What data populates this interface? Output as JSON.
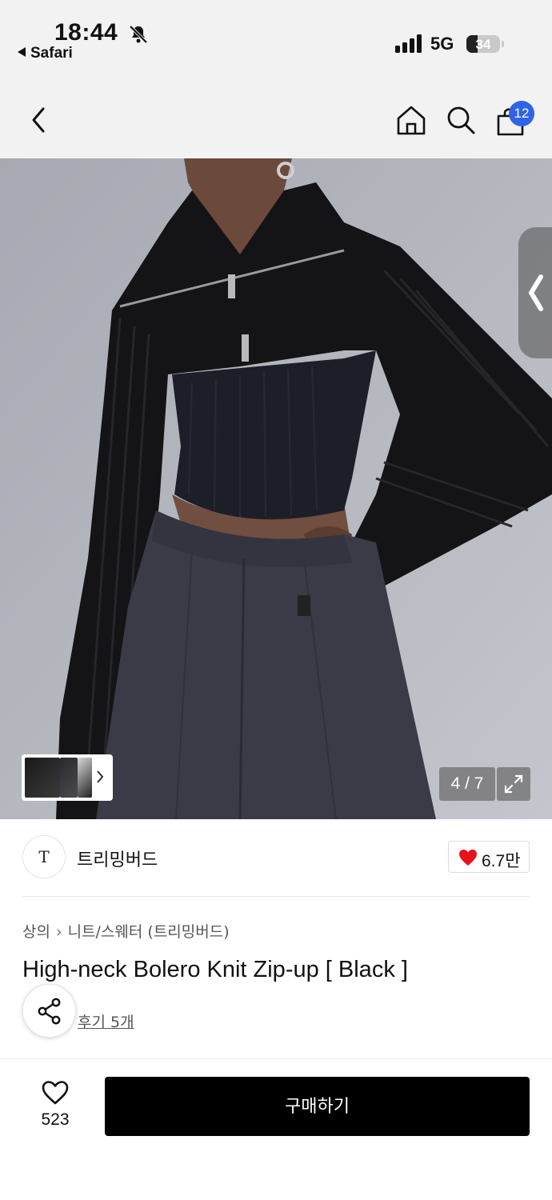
{
  "status_bar": {
    "time": "18:44",
    "back_app_label": "Safari",
    "network": "5G",
    "battery_level": "34",
    "battery_fraction": 0.34
  },
  "nav": {
    "back_icon": "chevron-left-icon",
    "home_icon": "home-icon",
    "search_icon": "search-icon",
    "bag_icon": "shopping-bag-icon",
    "cart_badge": "12",
    "badge_color": "#2f63e8"
  },
  "gallery": {
    "current": 4,
    "total": 7,
    "counter": "4 / 7",
    "expand_icon": "expand-icon"
  },
  "brand": {
    "logo_text": "T",
    "name": "트리밍버드",
    "like_count": "6.7만",
    "heart_color": "#e8111b"
  },
  "product": {
    "breadcrumb": [
      "상의",
      "니트/스웨터 (트리밍버드)"
    ],
    "title": "High-neck Bolero Knit Zip-up [ Black ]",
    "reviews_label": "후기 5개"
  },
  "bottom_bar": {
    "wish_count": "523",
    "buy_label": "구매하기"
  }
}
